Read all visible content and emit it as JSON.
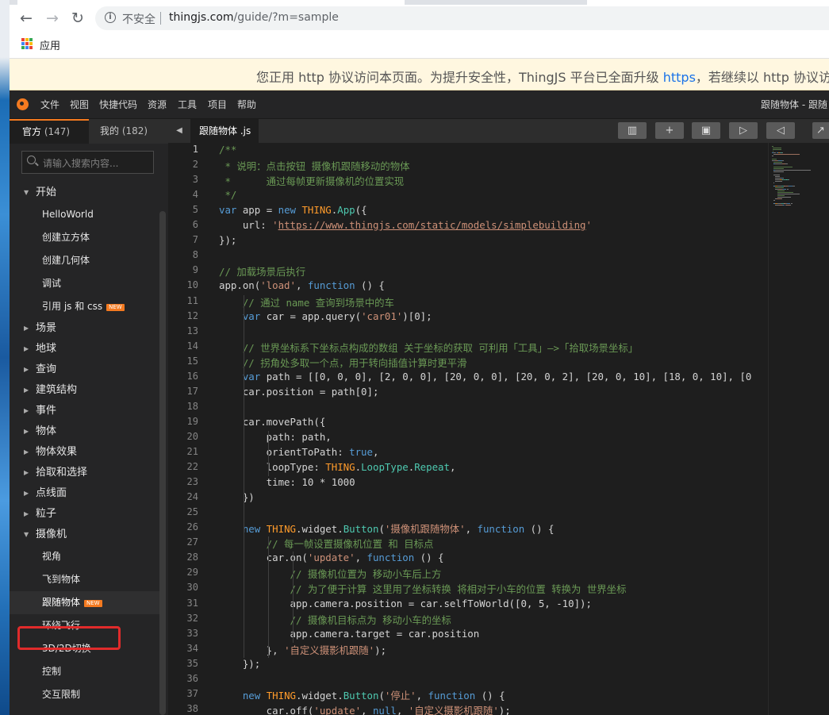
{
  "browser": {
    "security_label": "不安全",
    "url_host": "thingjs.com",
    "url_path": "/guide/?m=sample",
    "bookmarks_apps": "应用"
  },
  "banner": {
    "text_before": "您正用 http 协议访问本页面。为提升安全性，ThingJS 平台已全面升级 ",
    "link": "https",
    "text_after": "，若继续以 http 协议访问"
  },
  "ide": {
    "menu": [
      "文件",
      "视图",
      "快捷代码",
      "资源",
      "工具",
      "项目",
      "帮助"
    ],
    "window_title": "跟随物体 - 跟随"
  },
  "sidebar": {
    "tabs": [
      {
        "label": "官方",
        "count": "(147)"
      },
      {
        "label": "我的",
        "count": "(182)"
      }
    ],
    "search_placeholder": "请输入搜索内容...",
    "tree": [
      {
        "type": "group",
        "label": "开始",
        "expanded": true
      },
      {
        "type": "leaf",
        "label": "HelloWorld"
      },
      {
        "type": "leaf",
        "label": "创建立方体"
      },
      {
        "type": "leaf",
        "label": "创建几何体"
      },
      {
        "type": "leaf",
        "label": "调试"
      },
      {
        "type": "leaf",
        "label": "引用 js 和 css",
        "badge": "NEW"
      },
      {
        "type": "group",
        "label": "场景"
      },
      {
        "type": "group",
        "label": "地球"
      },
      {
        "type": "group",
        "label": "查询"
      },
      {
        "type": "group",
        "label": "建筑结构"
      },
      {
        "type": "group",
        "label": "事件"
      },
      {
        "type": "group",
        "label": "物体"
      },
      {
        "type": "group",
        "label": "物体效果"
      },
      {
        "type": "group",
        "label": "拾取和选择"
      },
      {
        "type": "group",
        "label": "点线面"
      },
      {
        "type": "group",
        "label": "粒子"
      },
      {
        "type": "group",
        "label": "摄像机",
        "expanded": true
      },
      {
        "type": "leaf",
        "label": "视角"
      },
      {
        "type": "leaf",
        "label": "飞到物体"
      },
      {
        "type": "leaf",
        "label": "跟随物体",
        "badge": "NEW",
        "selected": true
      },
      {
        "type": "leaf",
        "label": "环绕飞行"
      },
      {
        "type": "leaf",
        "label": "3D/2D切换"
      },
      {
        "type": "leaf",
        "label": "控制"
      },
      {
        "type": "leaf",
        "label": "交互限制"
      }
    ]
  },
  "editor": {
    "file_tab": "跟随物体 .js",
    "toolbar": [
      "chart-icon",
      "plus-icon",
      "save-icon",
      "play-icon",
      "send-icon",
      "external-icon"
    ],
    "current_line": 1,
    "lines": [
      [
        [
          "c",
          "/**"
        ]
      ],
      [
        [
          "c",
          " * 说明：点击按钮 摄像机跟随移动的物体"
        ]
      ],
      [
        [
          "c",
          " *      通过每帧更新摄像机的位置实现"
        ]
      ],
      [
        [
          "c",
          " */"
        ]
      ],
      [
        [
          "k",
          "var"
        ],
        [
          "n",
          " app = "
        ],
        [
          "k",
          "new "
        ],
        [
          "T",
          "THING"
        ],
        [
          "n",
          "."
        ],
        [
          "m",
          "App"
        ],
        [
          "n",
          "({"
        ]
      ],
      [
        [
          "n",
          "    url: "
        ],
        [
          "s",
          "'"
        ],
        [
          "u",
          "https://www.thingjs.com/static/models/simplebuilding"
        ],
        [
          "s",
          "'"
        ]
      ],
      [
        [
          "n",
          "});"
        ]
      ],
      [],
      [
        [
          "c",
          "// 加载场景后执行"
        ]
      ],
      [
        [
          "n",
          "app.on("
        ],
        [
          "s",
          "'load'"
        ],
        [
          "n",
          ", "
        ],
        [
          "k",
          "function"
        ],
        [
          "n",
          " () {"
        ]
      ],
      [
        [
          "c",
          "    // 通过 name 查询到场景中的车"
        ]
      ],
      [
        [
          "n",
          "    "
        ],
        [
          "k",
          "var"
        ],
        [
          "n",
          " car = app.query("
        ],
        [
          "s",
          "'car01'"
        ],
        [
          "n",
          ")[0];"
        ]
      ],
      [],
      [
        [
          "c",
          "    // 世界坐标系下坐标点构成的数组 关于坐标的获取 可利用「工具」—>「拾取场景坐标」"
        ]
      ],
      [
        [
          "c",
          "    // 拐角处多取一个点，用于转向插值计算时更平滑"
        ]
      ],
      [
        [
          "n",
          "    "
        ],
        [
          "k",
          "var"
        ],
        [
          "n",
          " path = [[0, 0, 0], [2, 0, 0], [20, 0, 0], [20, 0, 2], [20, 0, 10], [18, 0, 10], [0"
        ]
      ],
      [
        [
          "n",
          "    car.position = path[0];"
        ]
      ],
      [],
      [
        [
          "n",
          "    car.movePath({"
        ]
      ],
      [
        [
          "n",
          "        path: path,"
        ]
      ],
      [
        [
          "n",
          "        orientToPath: "
        ],
        [
          "k",
          "true"
        ],
        [
          "n",
          ","
        ]
      ],
      [
        [
          "n",
          "        loopType: "
        ],
        [
          "T",
          "THING"
        ],
        [
          "n",
          "."
        ],
        [
          "m",
          "LoopType"
        ],
        [
          "n",
          "."
        ],
        [
          "m",
          "Repeat"
        ],
        [
          "n",
          ","
        ]
      ],
      [
        [
          "n",
          "        time: 10 * 1000"
        ]
      ],
      [
        [
          "n",
          "    })"
        ]
      ],
      [],
      [
        [
          "n",
          "    "
        ],
        [
          "k",
          "new "
        ],
        [
          "T",
          "THING"
        ],
        [
          "n",
          ".widget."
        ],
        [
          "m",
          "Button"
        ],
        [
          "n",
          "("
        ],
        [
          "s",
          "'摄像机跟随物体'"
        ],
        [
          "n",
          ", "
        ],
        [
          "k",
          "function"
        ],
        [
          "n",
          " () {"
        ]
      ],
      [
        [
          "c",
          "        // 每一帧设置摄像机位置 和 目标点"
        ]
      ],
      [
        [
          "n",
          "        car.on("
        ],
        [
          "s",
          "'update'"
        ],
        [
          "n",
          ", "
        ],
        [
          "k",
          "function"
        ],
        [
          "n",
          " () {"
        ]
      ],
      [
        [
          "c",
          "            // 摄像机位置为 移动小车后上方"
        ]
      ],
      [
        [
          "c",
          "            // 为了便于计算 这里用了坐标转换 将相对于小车的位置 转换为 世界坐标"
        ]
      ],
      [
        [
          "n",
          "            app.camera.position = car.selfToWorld([0, 5, -10]);"
        ]
      ],
      [
        [
          "c",
          "            // 摄像机目标点为 移动小车的坐标"
        ]
      ],
      [
        [
          "n",
          "            app.camera.target = car.position"
        ]
      ],
      [
        [
          "n",
          "        }, "
        ],
        [
          "s",
          "'自定义摄影机跟随'"
        ],
        [
          "n",
          ");"
        ]
      ],
      [
        [
          "n",
          "    });"
        ]
      ],
      [],
      [
        [
          "n",
          "    "
        ],
        [
          "k",
          "new "
        ],
        [
          "T",
          "THING"
        ],
        [
          "n",
          ".widget."
        ],
        [
          "m",
          "Button"
        ],
        [
          "n",
          "("
        ],
        [
          "s",
          "'停止'"
        ],
        [
          "n",
          ", "
        ],
        [
          "k",
          "function"
        ],
        [
          "n",
          " () {"
        ]
      ],
      [
        [
          "n",
          "        car.off("
        ],
        [
          "s",
          "'update'"
        ],
        [
          "n",
          ", "
        ],
        [
          "k",
          "null"
        ],
        [
          "n",
          ", "
        ],
        [
          "s",
          "'自定义摄影机跟随'"
        ],
        [
          "n",
          ");"
        ]
      ]
    ]
  },
  "colors": {
    "accent": "#f47a20",
    "comment": "#6a9955",
    "keyword": "#569cd6",
    "string": "#ce9178",
    "thing_namespace": "#ff9b2b",
    "type": "#4ec9b0",
    "highlight_box": "#e02b2b"
  }
}
